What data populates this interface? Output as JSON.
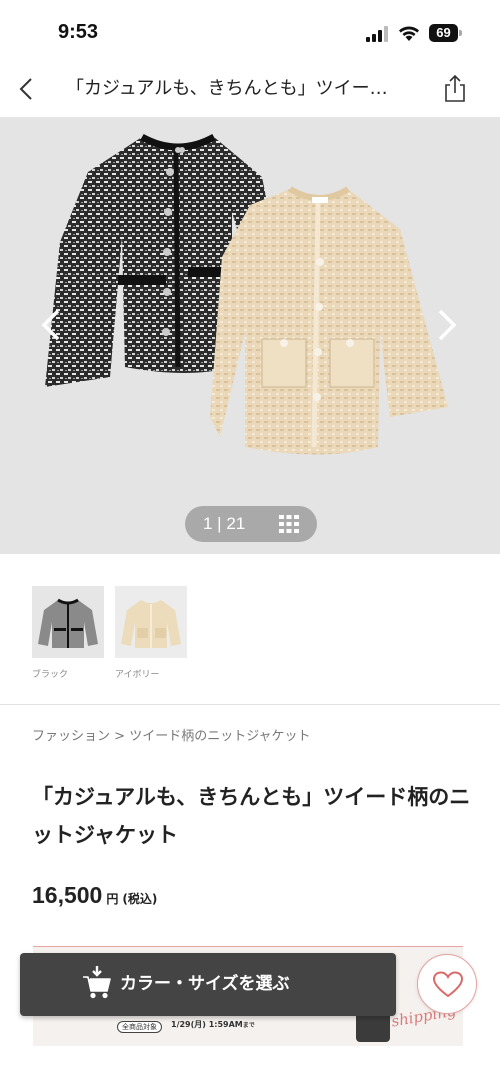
{
  "status_bar": {
    "time": "9:53",
    "battery": "69"
  },
  "header": {
    "title": "「カジュアルも、きちんとも」ツイー…"
  },
  "gallery": {
    "counter": "1 | 21"
  },
  "variants": [
    {
      "label": "ブラック"
    },
    {
      "label": "アイボリー"
    }
  ],
  "breadcrumb": {
    "category": "ファッション",
    "separator": " > ",
    "current": "ツイード柄のニットジャケット"
  },
  "product": {
    "title": "「カジュアルも、きちんとも」ツイード柄のニットジャケット",
    "price": "16,500",
    "price_unit": "円",
    "price_tax": "(税込)"
  },
  "banner": {
    "badge": "全商品対象",
    "date": "1/29(月) 1:59AM",
    "date_suffix": "まで",
    "script": "shipping"
  },
  "cta": {
    "label": "カラー・サイズを選ぶ"
  },
  "colors": {
    "cta_bg": "#444444",
    "fav_border": "#e5a2a2",
    "heart": "#d96b6b",
    "hero_bg": "#e4e4e4"
  }
}
